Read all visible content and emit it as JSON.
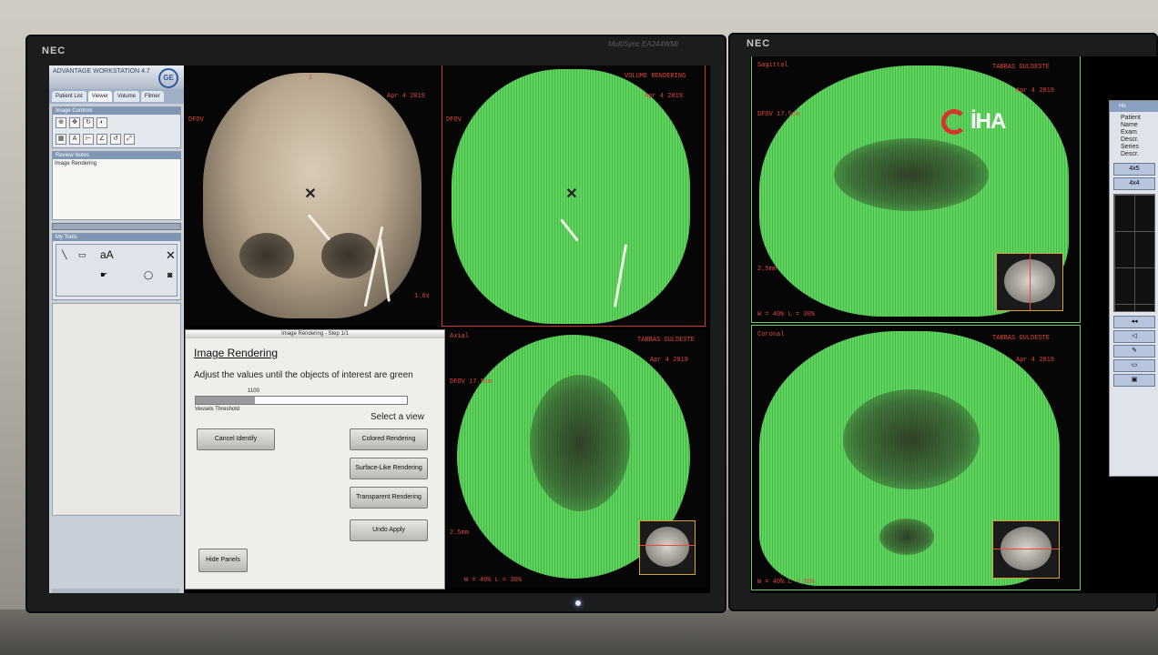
{
  "monitors": {
    "left": {
      "brand": "NEC",
      "model": "MultiSync EA244WMi"
    },
    "right": {
      "brand": "NEC"
    }
  },
  "toolpanel": {
    "title": "ADVANTAGE WORKSTATION 4.7",
    "logo": "GE",
    "tabs": [
      "Patient List",
      "Viewer",
      "Volume",
      "Filmer"
    ],
    "section_image_controls": "Image Controls",
    "section_review_notes": "Review Notes",
    "list_item": "Image Rendering",
    "section_tools": "My Tools",
    "tool_text": "aA"
  },
  "viewports": {
    "v3d": {
      "top_center": "1",
      "date": "Apr 4 2019",
      "label": "DFOV",
      "scale": "1.6x"
    },
    "vgreen": {
      "title": "VOLUME RENDERING",
      "label": "DFOV",
      "date": "Apr 4 2019"
    },
    "axial": {
      "orientation": "Axial",
      "patient": "TABBAS GULDESTE",
      "date": "Apr 4 2019",
      "dfov": "DFOV 17.5cm",
      "thickness": "2.5mm",
      "wl": "W = 40% L = 30%"
    },
    "sagittal": {
      "orientation": "Sagittal",
      "patient": "TABBAS GULDESTE",
      "date": "Apr 4 2019",
      "dfov": "DFOV 17.5cm",
      "thickness": "2.5mm",
      "wl": "W = 40% L = 30%"
    },
    "coronal": {
      "orientation": "Coronal",
      "patient": "TABBAS GULDESTE",
      "date": "Apr 4 2019",
      "wl": "W = 40% L = 30%"
    }
  },
  "dialog": {
    "titlebar": "Image Rendering - Step 1/1",
    "heading": "Image Rendering",
    "instruction": "Adjust the values until the objects of interest are green",
    "slider_value": "1100",
    "slider_caption": "Vessels Threshold",
    "select_view": "Select a view",
    "buttons": {
      "cancel": "Cancel Identify",
      "colored": "Colored Rendering",
      "surface": "Surface-Like Rendering",
      "transparent": "Transparent Rendering",
      "undo": "Undo Apply",
      "hide": "Hide Panels"
    }
  },
  "slider": {
    "threshold_fraction": 0.28
  },
  "side_panel": {
    "tab": "Ho",
    "fields": [
      "Patient",
      "Name",
      "Exam",
      "Descr.",
      "Series",
      "Descr."
    ],
    "buttons": [
      "4x5",
      "4x4"
    ]
  },
  "watermark": {
    "text": "İHA"
  },
  "colors": {
    "overlay_red": "#e0463c",
    "mask_green": "#5fd45f",
    "selected_outline": "#d0342c"
  }
}
